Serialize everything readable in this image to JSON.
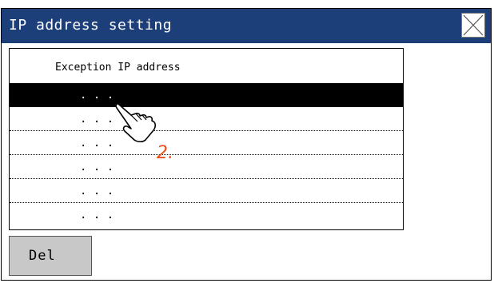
{
  "window": {
    "title": "IP address setting"
  },
  "list": {
    "header": "Exception IP address",
    "rows": [
      {
        "ip": ". . .",
        "selected": true
      },
      {
        "ip": ". . .",
        "selected": false
      },
      {
        "ip": ". . .",
        "selected": false
      },
      {
        "ip": ". . .",
        "selected": false
      },
      {
        "ip": ". . .",
        "selected": false
      },
      {
        "ip": ". . .",
        "selected": false
      }
    ]
  },
  "buttons": {
    "delete_label": "Del",
    "close_icon": "close-x-icon"
  },
  "annotation": {
    "step": "2.",
    "icon": "pointing-hand-icon"
  },
  "colors": {
    "title_bar": "#1c3f7a",
    "selected_row": "#000000",
    "button_bg": "#c8c8c8",
    "step_label": "#e8501c"
  }
}
